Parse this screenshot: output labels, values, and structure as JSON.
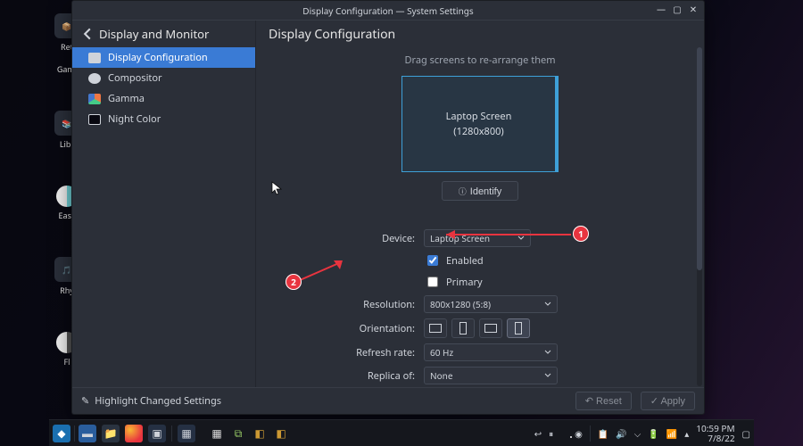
{
  "window": {
    "title": "Display Configuration — System Settings",
    "section": "Display and Monitor",
    "page_title": "Display Configuration"
  },
  "sidebar": {
    "items": [
      {
        "label": "Display Configuration"
      },
      {
        "label": "Compositor"
      },
      {
        "label": "Gamma"
      },
      {
        "label": "Night Color"
      }
    ]
  },
  "arrange": {
    "hint": "Drag screens to re-arrange them",
    "screen_name": "Laptop Screen",
    "screen_res": "(1280x800)",
    "identify": "Identify"
  },
  "form": {
    "device_label": "Device:",
    "device_value": "Laptop Screen",
    "enabled_label": "Enabled",
    "primary_label": "Primary",
    "resolution_label": "Resolution:",
    "resolution_value": "800x1280 (5:8)",
    "orientation_label": "Orientation:",
    "refresh_label": "Refresh rate:",
    "refresh_value": "60 Hz",
    "replica_label": "Replica of:",
    "replica_value": "None"
  },
  "footer": {
    "highlight": "Highlight Changed Settings",
    "reset": "Reset",
    "apply": "Apply"
  },
  "annotations": {
    "one": "1",
    "two": "2"
  },
  "taskbar": {
    "time": "10:59 PM",
    "date": "7/8/22"
  },
  "desktop_icons": [
    "Ret",
    "Gami",
    "Libr",
    "Easy",
    "Rhy",
    "Fl"
  ]
}
